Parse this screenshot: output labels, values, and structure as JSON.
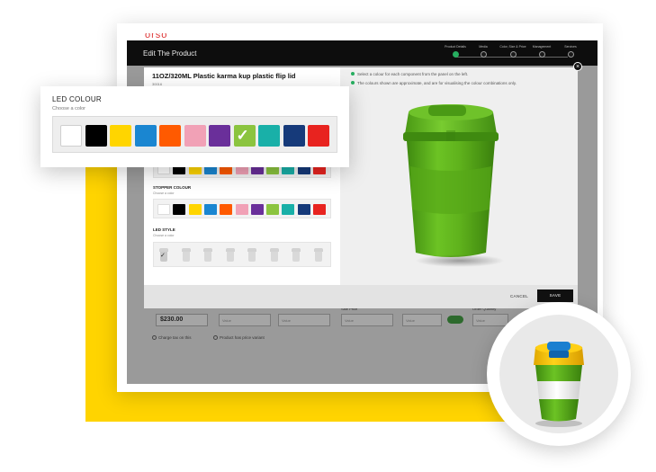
{
  "app": {
    "brand": "orso",
    "title": "Edit The Product",
    "steps": [
      {
        "label": "Product Details",
        "active": true
      },
      {
        "label": "Media",
        "active": false
      },
      {
        "label": "Color, Size & Price",
        "active": false
      },
      {
        "label": "Management",
        "active": false
      },
      {
        "label": "Services",
        "active": false
      }
    ]
  },
  "background_form": {
    "price": "$230.00",
    "field_placeholder": "Value",
    "labels": {
      "sale_price": "Sale Price",
      "order_quantity": "Order Quantity"
    },
    "radios": [
      "Charge tax on this",
      "Product has price variant"
    ]
  },
  "modal": {
    "product_title": "11OZ/320ML Plastic karma kup plastic flip lid",
    "product_code": "30016",
    "notes": [
      "Select a colour for each component from the panel on the left.",
      "The colours shown are approximate, and are for visualising the colour combinations only."
    ],
    "close_icon": "close-icon",
    "sections": [
      {
        "label": "STOPPER COLOUR",
        "sub": "Choose a color"
      },
      {
        "label": "LED STYLE",
        "sub": "Choose a color"
      }
    ],
    "cancel_label": "CANCEL",
    "save_label": "SAVE"
  },
  "led_colour": {
    "title": "LED COLOUR",
    "subtitle": "Choose a color",
    "selected_index": 7
  },
  "palette": [
    "#ffffff",
    "#000000",
    "#ffd500",
    "#1a86d1",
    "#ff5a00",
    "#f1a1b6",
    "#6a2f9a",
    "#8bc43f",
    "#19b0a8",
    "#163a7a",
    "#e8231f"
  ],
  "colors": {
    "cup_green": "#5fb21c",
    "cup_green_dark": "#3f8a10",
    "lid_yellow": "#f5c400",
    "stopper_blue": "#1a7fd0",
    "band_white": "#f4f4f4",
    "accent_yellow": "#ffd400"
  }
}
